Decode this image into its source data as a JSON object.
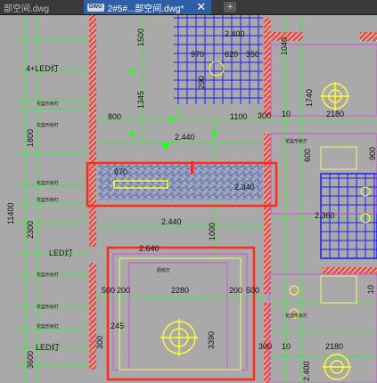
{
  "tabs": [
    {
      "label": "部空间.dwg",
      "active": false
    },
    {
      "label": "2#5#...部空间.dwg*",
      "active": true
    }
  ],
  "tab_icon": "DWG",
  "close_glyph": "✕",
  "new_tab_glyph": "+",
  "colors": {
    "canvas_bg": "#a9a9a9",
    "wall": "#d85c55",
    "dim_green": "#22ff22",
    "highlight": "#ff2a1a",
    "blue_grid": "#1a1aff"
  },
  "drawing": {
    "dims": {
      "d1500": "1500",
      "d2400a": "2.400",
      "d970a": "970",
      "d620": "620",
      "d350": "350",
      "d1040": "1040",
      "d290": "290",
      "d1345": "1345",
      "d800": "800",
      "d1100": "1100",
      "d300a": "300",
      "d10a": "10",
      "d2180a": "2180",
      "d1740": "1740",
      "d1800": "1800",
      "d2440a": "2.440",
      "d600": "600",
      "d900": "900",
      "d970b": "970",
      "d2340": "2.340",
      "d11400": "11400",
      "d2300": "2300",
      "d2360": "2.360",
      "d2440b": "2.440",
      "d1000": "1000",
      "d2640": "2.640",
      "d500a": "500",
      "d200a": "200",
      "d2280": "2280",
      "d200b": "200",
      "d500b": "500",
      "d10b": "10",
      "d245": "245",
      "d3390": "3390",
      "d300b": "300",
      "d3600": "3600",
      "d2180b": "2180",
      "d10c": "10",
      "d2400b": "2.400"
    },
    "labels": {
      "led4": "4+LED灯",
      "led_left": "LED灯",
      "led_bottom": "LED灯",
      "small1": "花篮形射灯",
      "small2": "花篮形射灯",
      "small3": "花篮形射灯",
      "small4": "花篮形射灯",
      "small5": "花篮形射灯",
      "small6": "花篮形射灯",
      "small7": "花篮形射灯",
      "small8": "花篮形射灯",
      "small9": "花篮形射灯",
      "room": "厨房灯"
    }
  }
}
